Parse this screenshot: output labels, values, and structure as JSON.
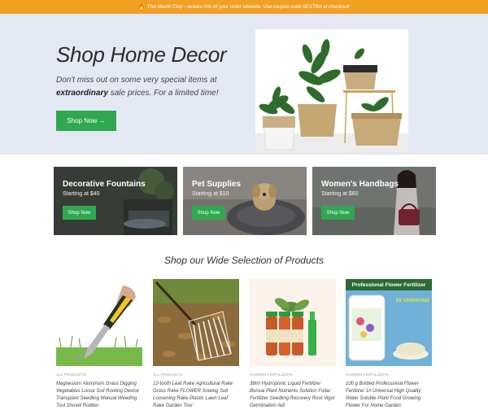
{
  "announcement": {
    "icon": "fire-icon",
    "text": "This Month Only - receive 5% off your order sitewide. Use coupon code SEXTRA at checkout!"
  },
  "hero": {
    "title": "Shop Home Decor",
    "subtitle_pre": "Don't miss out on some very special items at",
    "subtitle_bold": "extraordinary",
    "subtitle_post": "sale prices. For a limited time!",
    "button_label": "Shop Now →"
  },
  "categories": [
    {
      "title": "Decorative Fountains",
      "subtitle": "Starting at $40",
      "button_label": "Shop Now"
    },
    {
      "title": "Pet Supplies",
      "subtitle": "Starting at $10",
      "button_label": "Shop Now"
    },
    {
      "title": "Women's Handbags",
      "subtitle": "Starting at $60",
      "button_label": "Shop Now"
    }
  ],
  "section_title": "Shop our Wide Selection of Products",
  "products": [
    {
      "category": "ALL PRODUCTS",
      "name": "Magnesium Aluminum Grass Digging Vegetables Loose Soil Rooting Device Transplant Seedling Manual Weeding Tool Shovel Rubber"
    },
    {
      "category": "ALL PRODUCTS",
      "name": "12-tooth Leaf Rake Agricultural Rake Grass Rake FLOWER Sowing Soil Loosening Rake Plastic Lawn Leaf Rake Garden Tool"
    },
    {
      "category": "GARDEN FERTILIZERS",
      "name": "38ml Hydroponic Liquid Fertilizer Bonsai Plant Nutrients Solution Foliar Fertilizer Seedling Recovery Root Vigor Germination Aid"
    },
    {
      "category": "GARDEN FERTILIZERS",
      "name": "100 g Bottled Professional Flower Fertilizer 1# Universal High Quality Water Soluble Plant Food Growing Flower For Home Garden"
    }
  ],
  "product_images": [
    {
      "banner": "",
      "label": ""
    },
    {
      "banner": "",
      "label": ""
    },
    {
      "banner": "",
      "label": ""
    },
    {
      "banner": "Professional Flower Fertilizer",
      "label": "1# Universal"
    }
  ],
  "colors": {
    "accent": "#2fa84f",
    "topbar": "#f2a024",
    "hero_bg": "#e4e8f3"
  }
}
